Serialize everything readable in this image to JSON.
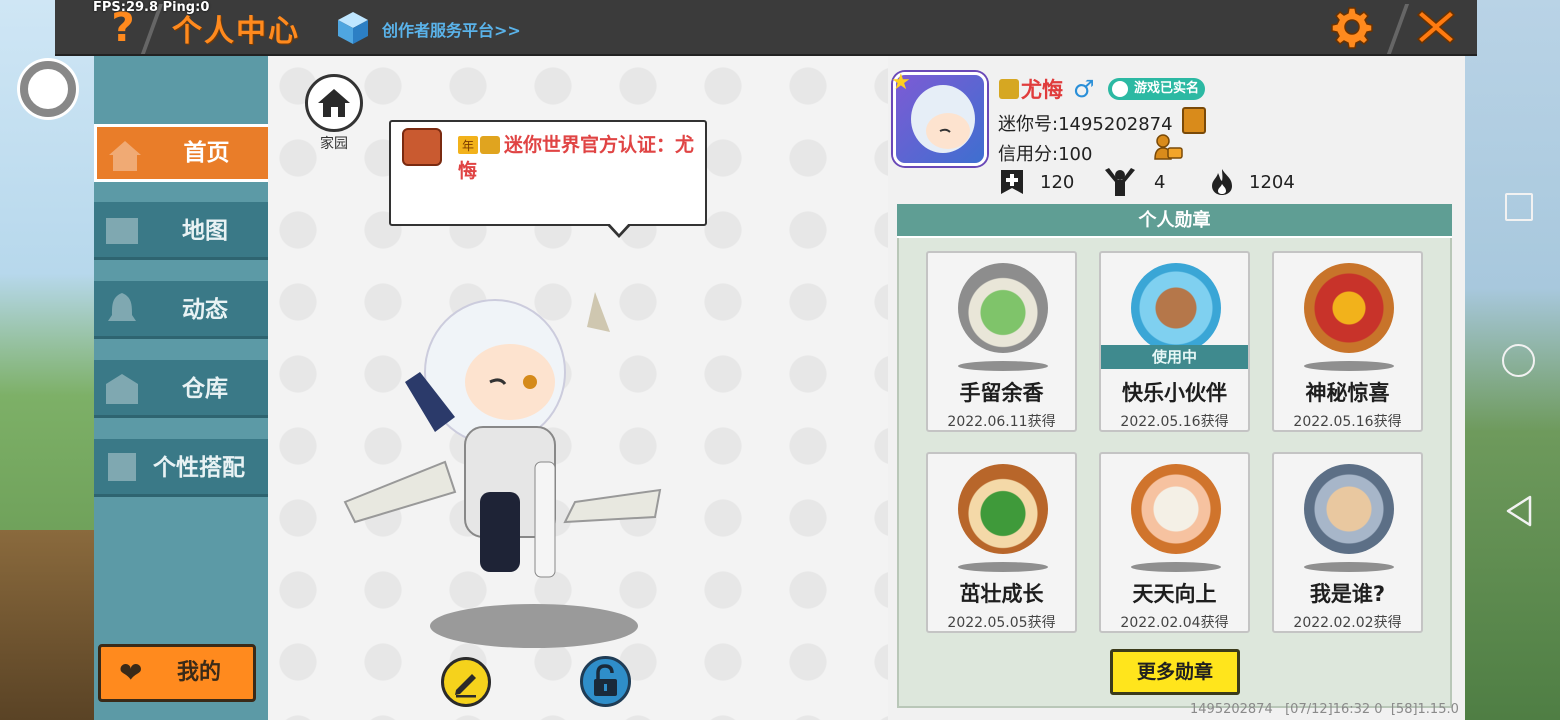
{
  "debug": {
    "fps_ping": "FPS:29.8  Ping:0"
  },
  "topbar": {
    "help_icon": "question-icon",
    "title": "个人中心",
    "creator_link": "创作者服务平台>>",
    "settings_icon": "gear-icon",
    "close_icon": "close-icon"
  },
  "sidebar": {
    "items": [
      {
        "label": "首页",
        "icon": "house-icon",
        "active": true
      },
      {
        "label": "地图",
        "icon": "map-icon",
        "active": false
      },
      {
        "label": "动态",
        "icon": "bell-icon",
        "active": false
      },
      {
        "label": "仓库",
        "icon": "warehouse-icon",
        "active": false
      },
      {
        "label": "个性搭配",
        "icon": "outfit-icon",
        "active": false
      }
    ],
    "mine_label": "我的"
  },
  "stage": {
    "home_label": "家园",
    "bubble_text": "迷你世界官方认证：尤悔",
    "bubble_badge": "年"
  },
  "profile": {
    "nickname": "尤悔",
    "gender": "♂",
    "verified": "游戏已实名",
    "uid": "迷你号:1495202874",
    "credit": "信用分:100",
    "stats": [
      {
        "icon": "plus-flag-icon",
        "value": "120"
      },
      {
        "icon": "cheer-icon",
        "value": "4"
      },
      {
        "icon": "flame-icon",
        "value": "1204"
      }
    ]
  },
  "medals": {
    "header": "个人勋章",
    "in_use_label": "使用中",
    "items": [
      {
        "name": "手留余香",
        "date": "2022.06.11获得",
        "in_use": false,
        "color": "#9a9a9a"
      },
      {
        "name": "快乐小伙伴",
        "date": "2022.05.16获得",
        "in_use": true,
        "color": "#52c8e8"
      },
      {
        "name": "神秘惊喜",
        "date": "2022.05.16获得",
        "in_use": false,
        "color": "#c8742a"
      },
      {
        "name": "茁壮成长",
        "date": "2022.05.05获得",
        "in_use": false,
        "color": "#b8662a"
      },
      {
        "name": "天天向上",
        "date": "2022.02.04获得",
        "in_use": false,
        "color": "#d0742c"
      },
      {
        "name": "我是谁?",
        "date": "2022.02.02获得",
        "in_use": false,
        "color": "#5c6f86"
      }
    ],
    "more_label": "更多勋章"
  },
  "footer": {
    "info": "1495202874   [07/12]16:32 0  [58]1.15.0"
  },
  "colors": {
    "accent": "#ff8a1e",
    "sidebar": "#3a7987",
    "medal_header": "#5f9e94"
  }
}
